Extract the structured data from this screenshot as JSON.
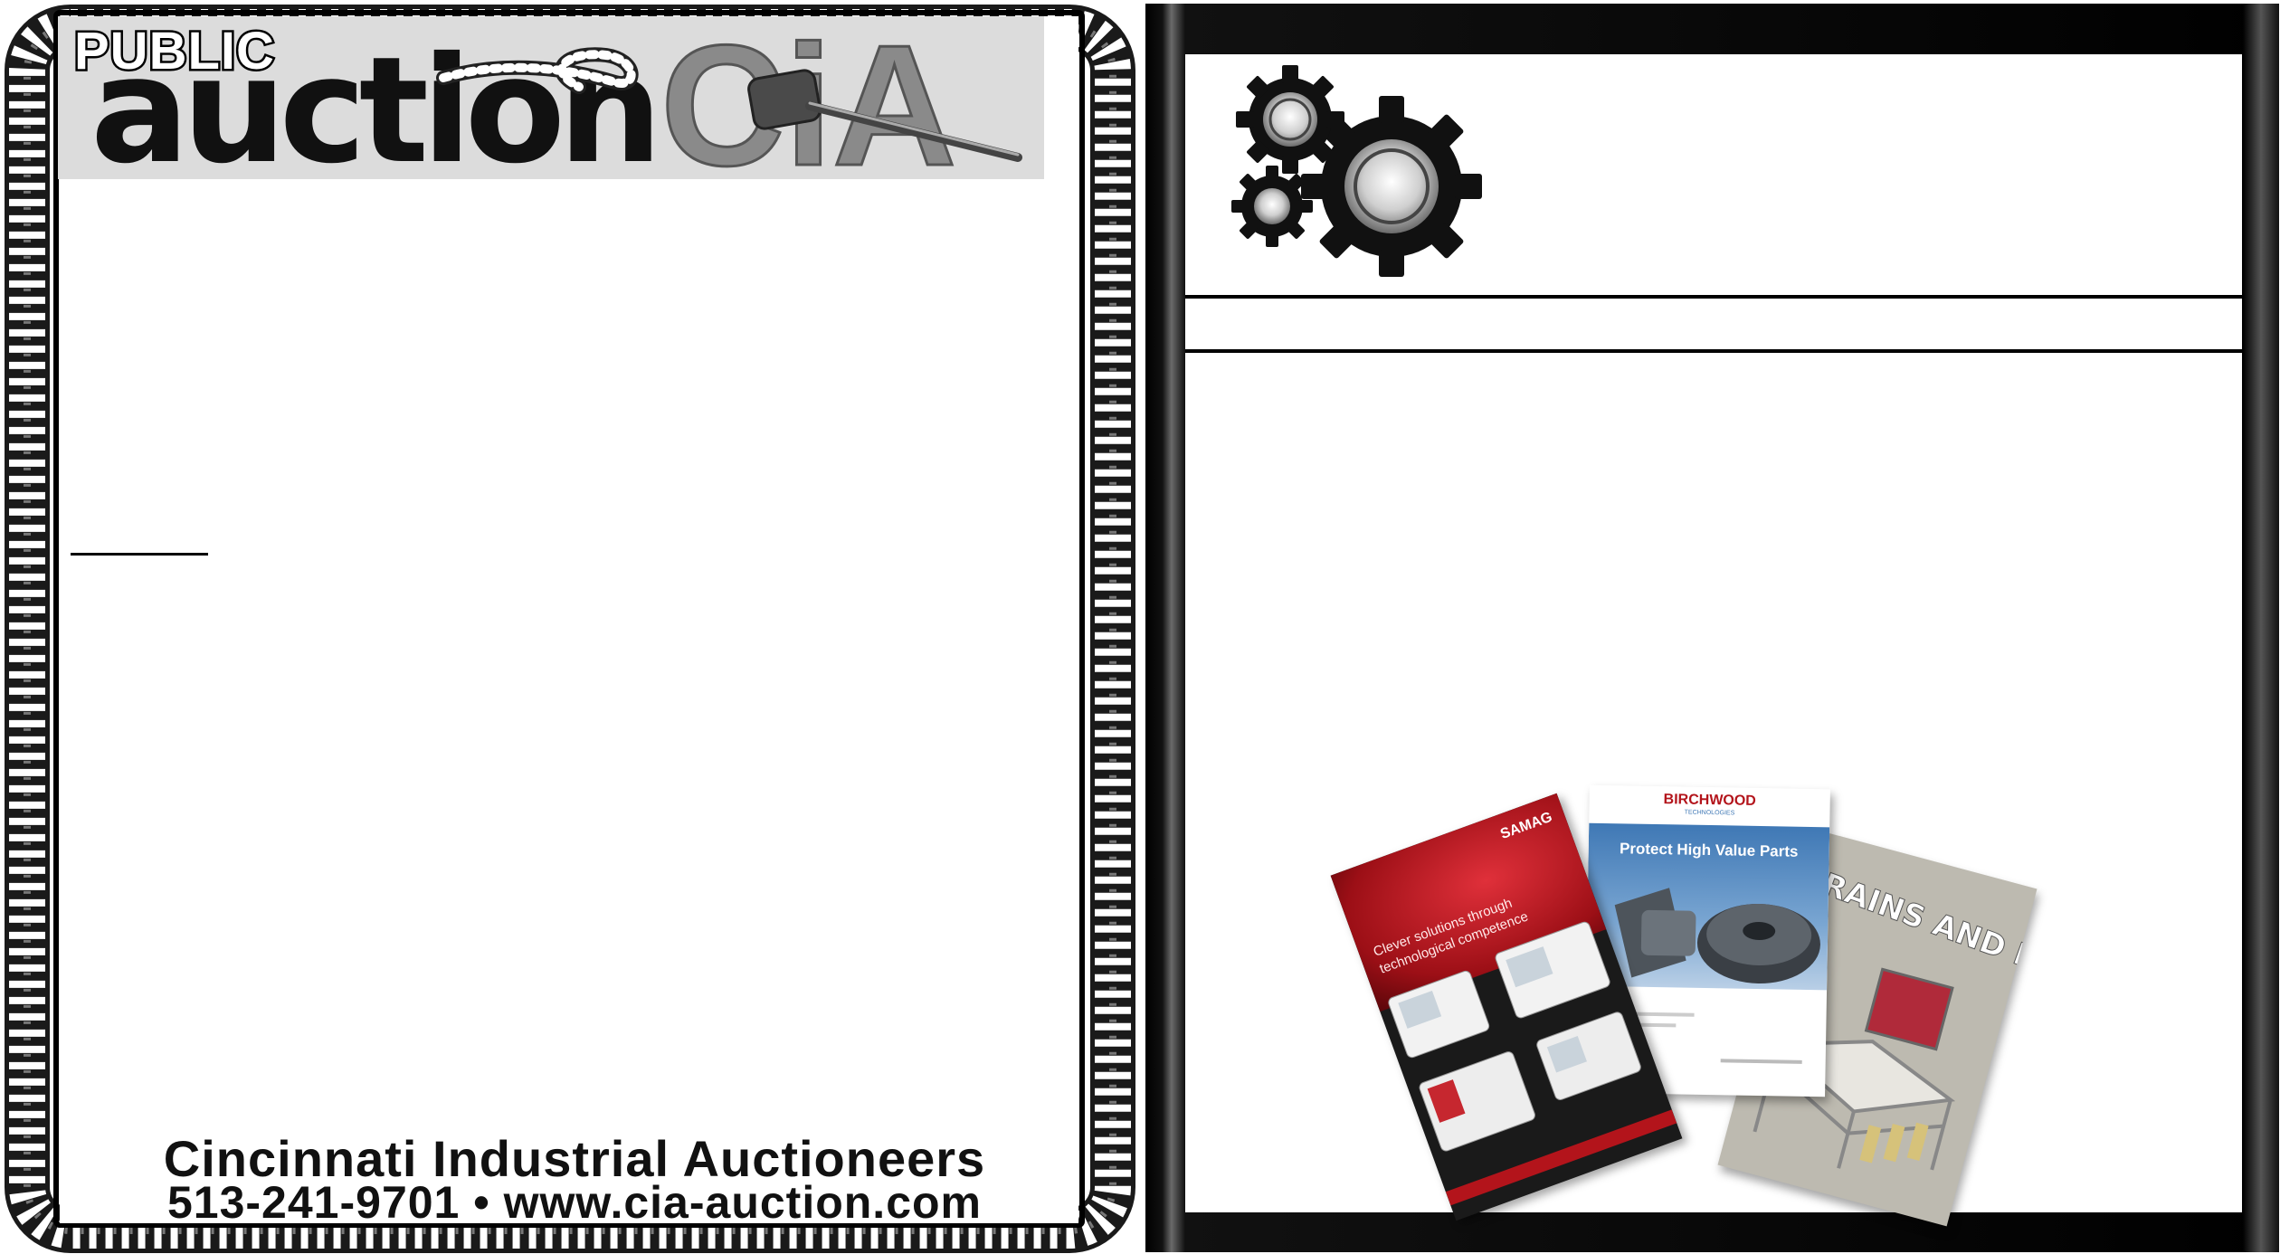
{
  "auction_ad": {
    "public_label": "PUBLIC",
    "auction_label": "auction",
    "logo_text": "CiA",
    "company_name": "Cincinnati Industrial Auctioneers",
    "contact": "513-241-9701 • www.cia-auction.com"
  },
  "brochures": {
    "samag": {
      "brand": "SAMAG",
      "tagline_line1": "Clever solutions through",
      "tagline_line2": "technological competence"
    },
    "birchwood": {
      "brand": "BIRCHWOOD",
      "brand_sub": "TECHNOLOGIES",
      "headline": "Protect High Value Parts"
    },
    "brains": {
      "headline": "BRAINS AND BRAWN"
    }
  },
  "colors": {
    "banner_gray": "#dcdcdc",
    "frame_black": "#000000",
    "samag_red": "#b3141b",
    "birchwood_blue": "#3f78b5"
  },
  "icons": [
    "gears-icon",
    "gavel-icon",
    "rope-frame"
  ]
}
